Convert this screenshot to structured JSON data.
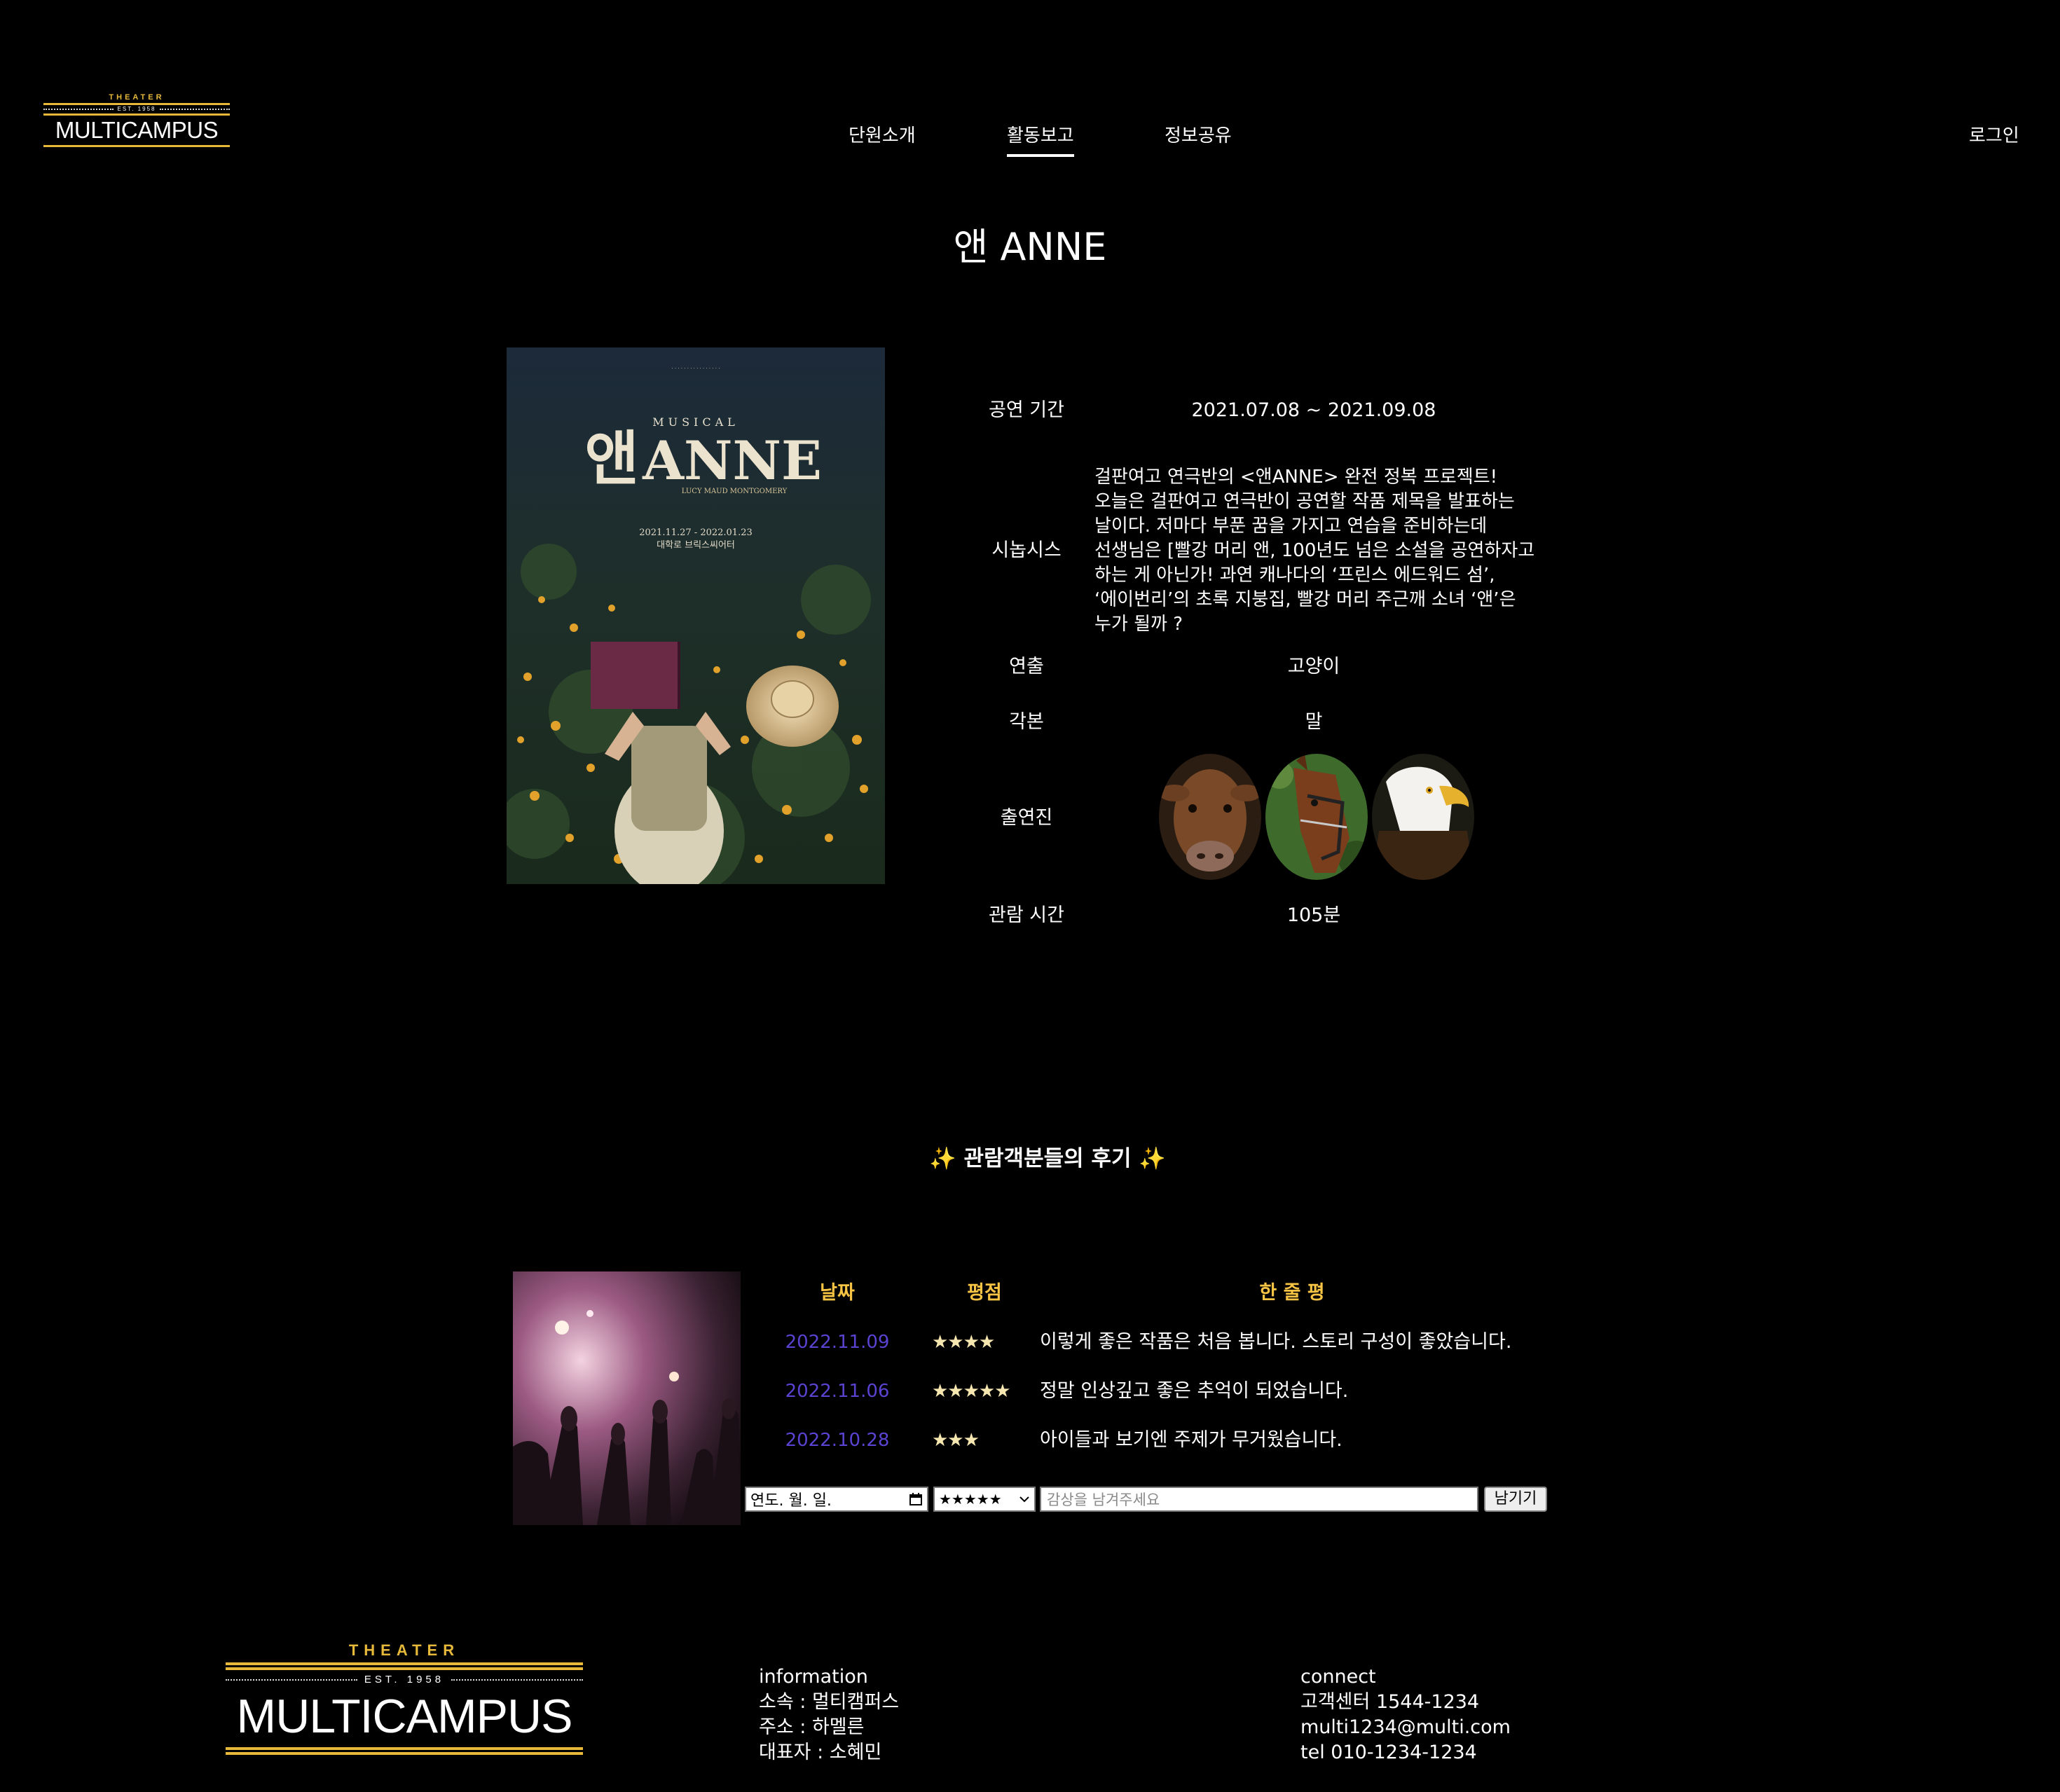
{
  "logo": {
    "top": "THEATER",
    "est": "EST. 1958",
    "name": "MULTICAMPUS"
  },
  "nav": {
    "items": [
      "단원소개",
      "활동보고",
      "정보공유"
    ],
    "active_index": 1,
    "login": "로그인"
  },
  "page_title": "앤 ANNE",
  "poster": {
    "subtitle": "MUSICAL",
    "title_kr": "앤",
    "title_en": "ANNE",
    "author": "LUCY MAUD MONTGOMERY",
    "dates": "2021.11.27 - 2022.01.23",
    "venue": "대학로 브릭스씨어터"
  },
  "info": {
    "period_label": "공연 기간",
    "period_value": "2021.07.08 ~ 2021.09.08",
    "synopsis_label": "시놉시스",
    "synopsis_value": "걸판여고 연극반의 <앤ANNE> 완전 정복 프로젝트! 오늘은 걸판여고 연극반이 공연할 작품 제목을 발표하는 날이다. 저마다 부푼 꿈을 가지고 연습을 준비하는데 선생님은 [빨강 머리 앤, 100년도 넘은 소설을 공연하자고 하는 게 아닌가! 과연 캐나다의 ‘프린스 에드워드 섬’, ‘에이번리’의 초록 지붕집, 빨강 머리 주근깨 소녀 ‘앤’은 누가 될까 ?",
    "director_label": "연출",
    "director_value": "고양이",
    "writer_label": "각본",
    "writer_value": "말",
    "cast_label": "출연진",
    "cast_icons": [
      "cow-photo",
      "horse-photo",
      "eagle-photo"
    ],
    "runtime_label": "관람 시간",
    "runtime_value": "105분"
  },
  "reviews": {
    "title": "✨ 관람객분들의 후기 ✨",
    "headers": {
      "date": "날짜",
      "rating": "평점",
      "comment": "한 줄 평"
    },
    "rows": [
      {
        "date": "2022.11.09",
        "stars": "★★★★",
        "rating": 4,
        "text": "이렇게 좋은 작품은 처음 봅니다. 스토리 구성이 좋았습니다."
      },
      {
        "date": "2022.11.06",
        "stars": "★★★★★",
        "rating": 5,
        "text": "정말 인상깊고 좋은 추억이 되었습니다."
      },
      {
        "date": "2022.10.28",
        "stars": "★★★",
        "rating": 3,
        "text": "아이들과 보기엔 주제가 무거웠습니다."
      }
    ],
    "form": {
      "date_placeholder": "연도. 월. 일.",
      "rating_selected": "★★★★★",
      "comment_placeholder": "감상을 남겨주세요",
      "submit_label": "남기기"
    }
  },
  "footer": {
    "information": {
      "heading": "information",
      "affiliation": "소속 : 멀티캠퍼스",
      "address": "주소 : 하멜른",
      "ceo": "대표자 : 소혜민"
    },
    "connect": {
      "heading": "connect",
      "center": "고객센터 1544-1234",
      "email": "multi1234@multi.com",
      "tel": "tel 010-1234-1234"
    }
  },
  "colors": {
    "background": "#000000",
    "gold": "#e6b93a",
    "header_yellow": "#f6c344",
    "date_purple": "#5a43d0"
  }
}
